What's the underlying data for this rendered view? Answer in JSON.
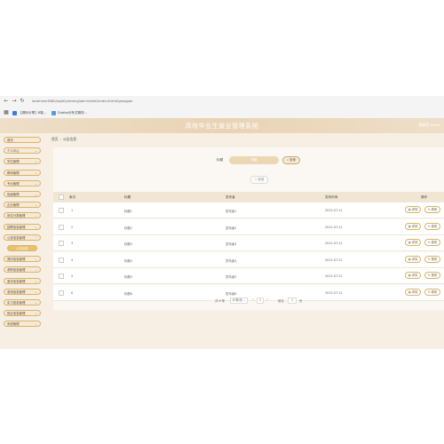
{
  "browser": {
    "url": "localhost:8080/jsp/biyesheng/admin/dist/index.html#/gonggao",
    "bookmarks": [
      {
        "label": "【源码分享】B端...",
        "color": "#3b7ddd"
      },
      {
        "label": "Dubbo分布式服务...",
        "color": "#5b9bd5"
      }
    ]
  },
  "app": {
    "title": "高校毕业生就业管理系统",
    "user": "管理员 admin"
  },
  "sidebar": {
    "items": [
      {
        "label": "首页",
        "chevron": ""
      },
      {
        "label": "个人中心",
        "chevron": "⌄"
      },
      {
        "label": "学生管理",
        "chevron": "⌄"
      },
      {
        "label": "教师管理",
        "chevron": "⌄"
      },
      {
        "label": "专业管理",
        "chevron": "⌄"
      },
      {
        "label": "班级管理",
        "chevron": "⌄"
      },
      {
        "label": "企业管理",
        "chevron": "⌄"
      },
      {
        "label": "岗位分类管理",
        "chevron": "⌄"
      },
      {
        "label": "招聘信息管理",
        "chevron": "⌄"
      },
      {
        "label": "公告信息管理",
        "chevron": "⌃"
      },
      {
        "label": "公告信息",
        "chevron": "",
        "sub": true
      },
      {
        "label": "简历信息管理",
        "chevron": "⌄"
      },
      {
        "label": "求职信息管理",
        "chevron": "⌄"
      },
      {
        "label": "面试信息管理",
        "chevron": "⌄"
      },
      {
        "label": "录用信息管理",
        "chevron": "⌄"
      },
      {
        "label": "实习信息管理",
        "chevron": "⌄"
      },
      {
        "label": "就业信息管理",
        "chevron": "⌄"
      },
      {
        "label": "系统管理",
        "chevron": "⌄"
      }
    ]
  },
  "breadcrumb": {
    "home": "首页",
    "current": "公告信息"
  },
  "search": {
    "label": "标题",
    "placeholder": "标题",
    "button": "查询"
  },
  "add_button": "新增",
  "table": {
    "headers": [
      "索引",
      "标题",
      "发布者",
      "发布时间",
      "操作"
    ],
    "rows": [
      {
        "index": "1",
        "title": "标题1",
        "publisher": "发布者1",
        "time": "2022-07-21"
      },
      {
        "index": "2",
        "title": "标题2",
        "publisher": "发布者2",
        "time": "2022-07-21"
      },
      {
        "index": "3",
        "title": "标题3",
        "publisher": "发布者3",
        "time": "2022-07-21"
      },
      {
        "index": "4",
        "title": "标题4",
        "publisher": "发布者4",
        "time": "2022-07-21"
      },
      {
        "index": "5",
        "title": "标题5",
        "publisher": "发布者5",
        "time": "2022-07-21"
      },
      {
        "index": "6",
        "title": "标题6",
        "publisher": "发布者6",
        "time": "2022-07-21"
      }
    ],
    "action_detail": "详情",
    "action_edit": "修改"
  },
  "pager": {
    "total": "共 6 条",
    "page_size": "10条/页",
    "prev": "‹",
    "current": "1",
    "next": "›",
    "goto_label": "前往",
    "goto_value": "1",
    "page_unit": "页"
  },
  "colors": {
    "accent": "#e9c06b",
    "border": "#d9b46a",
    "bg": "#f7efe4"
  }
}
